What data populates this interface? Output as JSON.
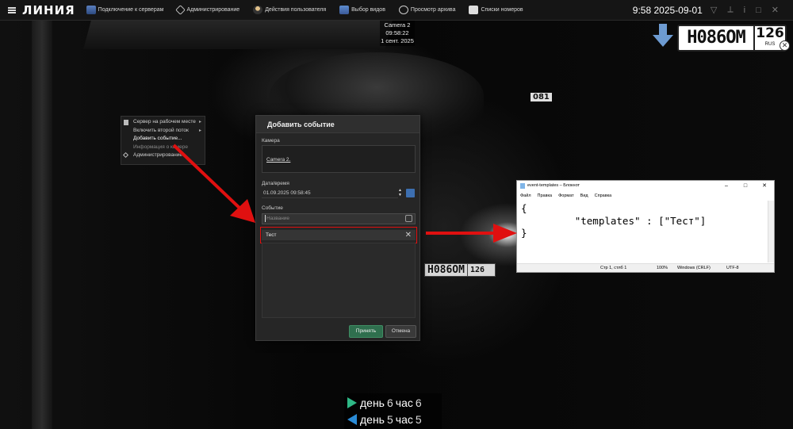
{
  "app": {
    "logo": "ЛИНИЯ"
  },
  "menu": {
    "servers": "Подключение к серверам",
    "admin": "Администрирование",
    "user_actions": "Действия пользователя",
    "view_select": "Выбор видов",
    "archive": "Просмотр архива",
    "plate_lists": "Списки номеров"
  },
  "clock": "9:58 2025-09-01",
  "camera": {
    "name": "Camera 2",
    "time": "09:58:22",
    "date": "1 сент. 2025",
    "plate_scene_small": "081",
    "plate_scene_number": "Н086ОМ",
    "plate_scene_region": "126"
  },
  "recognized_plate": {
    "number": "Н086ОМ",
    "region": "126",
    "country": "RUS"
  },
  "context_menu": {
    "items": [
      {
        "label": "Сервер на рабочем месте",
        "submenu": true
      },
      {
        "label": "Включить второй поток",
        "submenu": true
      },
      {
        "label": "Добавить событие..."
      },
      {
        "label": "Информация о камере"
      },
      {
        "label": "Администрирование"
      }
    ]
  },
  "dialog": {
    "title": "Добавить событие",
    "camera_label": "Камера",
    "camera_value": "Camera 2.",
    "datetime_label": "Дата/время",
    "datetime_value": "01.09.2025 09:58:45",
    "event_label": "Событие",
    "event_placeholder": "Название",
    "template_item": "Тест",
    "ok_label": "Принять",
    "cancel_label": "Отмена"
  },
  "notepad": {
    "title": "event-templates – Блокнот",
    "menu": [
      "Файл",
      "Правка",
      "Формат",
      "Вид",
      "Справка"
    ],
    "content": "{\n         \"templates\" : [\"Тест\"]\n}",
    "status_pos": "Стр 1, стлб 1",
    "status_zoom": "100%",
    "status_eol": "Windows (CRLF)",
    "status_enc": "UTF-8"
  },
  "timeline": {
    "forward": {
      "day_label": "день",
      "day": "6",
      "hour_label": "час",
      "hour": "6"
    },
    "backward": {
      "day_label": "день",
      "day": "5",
      "hour_label": "час",
      "hour": "5"
    }
  },
  "colors": {
    "highlight_red": "#e01010",
    "accept_green": "#2f6f4e",
    "forward_green": "#2eb886",
    "backward_blue": "#2a8bd6"
  }
}
